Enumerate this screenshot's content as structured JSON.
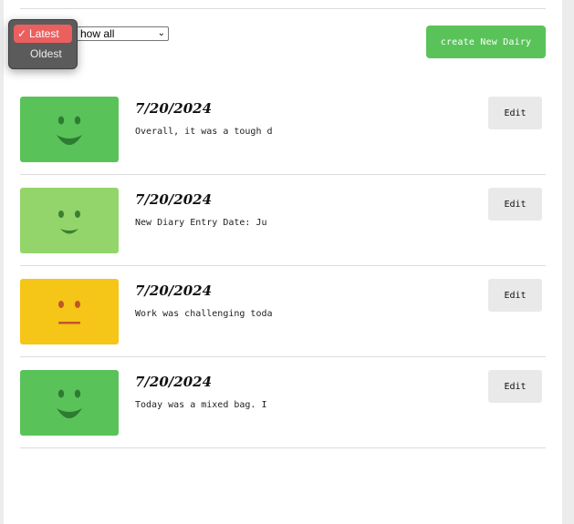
{
  "filter": {
    "selected_value": "Show all",
    "visible_text": "how all"
  },
  "sort_menu": {
    "options": [
      {
        "label": "Latest",
        "selected": true
      },
      {
        "label": "Oldest",
        "selected": false
      }
    ],
    "check_glyph": "✓"
  },
  "create_button": {
    "label": "create New Dairy"
  },
  "entries": [
    {
      "date": "7/20/2024",
      "snippet": "Overall, it was a tough d",
      "mood": "happy",
      "mood_color": "#59c35a",
      "edit_label": "Edit"
    },
    {
      "date": "7/20/2024",
      "snippet": "New Diary Entry Date: Ju",
      "mood": "content",
      "mood_color": "#93d56a",
      "edit_label": "Edit"
    },
    {
      "date": "7/20/2024",
      "snippet": "Work was challenging toda",
      "mood": "neutral",
      "mood_color": "#f5c518",
      "edit_label": "Edit"
    },
    {
      "date": "7/20/2024",
      "snippet": "Today was a mixed bag. I",
      "mood": "happy",
      "mood_color": "#59c35a",
      "edit_label": "Edit"
    }
  ],
  "colors": {
    "accent_green": "#59c35a",
    "selected_option": "#ec5f5f",
    "menu_bg": "#5b5b5b"
  }
}
